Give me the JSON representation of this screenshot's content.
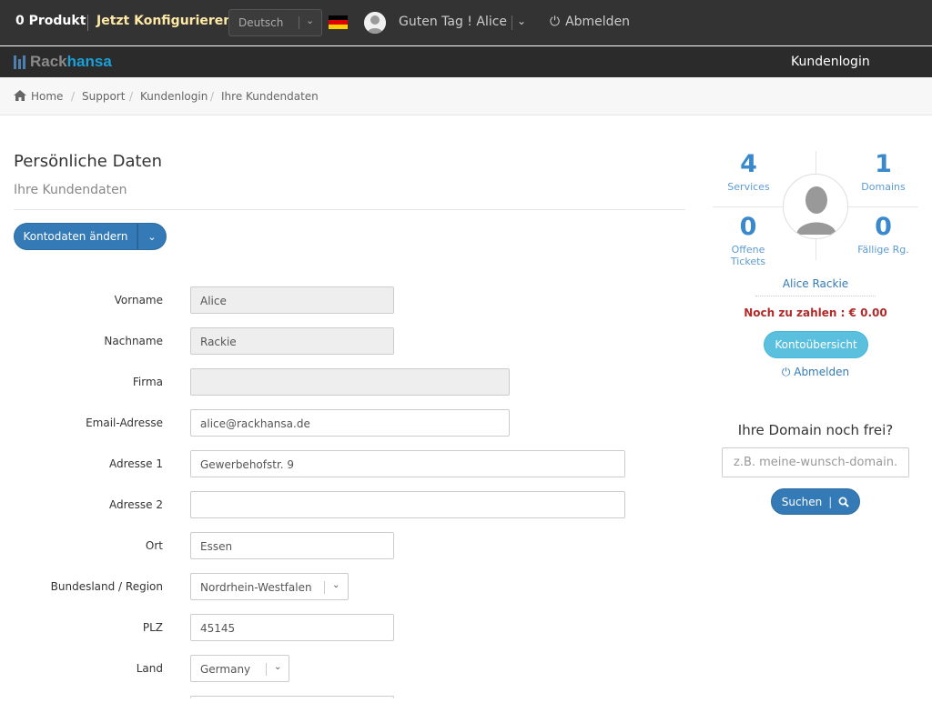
{
  "topbar": {
    "cart_label": "0 Produkt",
    "config_label": "Jetzt Konfigurieren",
    "language": "Deutsch",
    "greeting": "Guten Tag ! Alice",
    "logout_label": "Abmelden"
  },
  "brand": {
    "part1": "Rack",
    "part2": "hansa",
    "color_accent": "#1aa0d8"
  },
  "nav": {
    "login_label": "Kundenlogin"
  },
  "breadcrumb": [
    "Home",
    "Support",
    "Kundenlogin",
    "Ihre Kundendaten"
  ],
  "page": {
    "title": "Persönliche Daten",
    "subtitle": "Ihre Kundendaten",
    "edit_button": "Kontodaten ändern"
  },
  "form": {
    "vorname": {
      "label": "Vorname",
      "value": "Alice"
    },
    "nachname": {
      "label": "Nachname",
      "value": "Rackie"
    },
    "firma": {
      "label": "Firma",
      "value": ""
    },
    "email": {
      "label": "Email-Adresse",
      "value": "alice@rackhansa.de"
    },
    "adresse1": {
      "label": "Adresse 1",
      "value": "Gewerbehofstr. 9"
    },
    "adresse2": {
      "label": "Adresse 2",
      "value": ""
    },
    "ort": {
      "label": "Ort",
      "value": "Essen"
    },
    "region": {
      "label": "Bundesland / Region",
      "value": "Nordrhein-Westfalen"
    },
    "plz": {
      "label": "PLZ",
      "value": "45145"
    },
    "land": {
      "label": "Land",
      "value": "Germany"
    }
  },
  "sidebar": {
    "stats": {
      "services": {
        "value": "4",
        "label": "Services"
      },
      "domains": {
        "value": "1",
        "label": "Domains"
      },
      "tickets": {
        "value": "0",
        "label": "Offene Tickets"
      },
      "invoices": {
        "value": "0",
        "label": "Fällige Rg."
      }
    },
    "name": "Alice Rackie",
    "due": "Noch zu zahlen : € 0.00",
    "overview_button": "Kontoübersicht",
    "logout_label": "Abmelden"
  },
  "domain_search": {
    "title": "Ihre Domain noch frei?",
    "placeholder": "z.B. meine-wunsch-domain.de",
    "button": "Suchen"
  },
  "colors": {
    "primary": "#337ab7",
    "info": "#5bc0de",
    "topbar": "#333333",
    "due": "#b02a2a"
  },
  "icons": [
    "home-icon",
    "power-icon",
    "chevron-down-icon",
    "search-icon",
    "user-avatar-icon",
    "flag-de-icon"
  ]
}
